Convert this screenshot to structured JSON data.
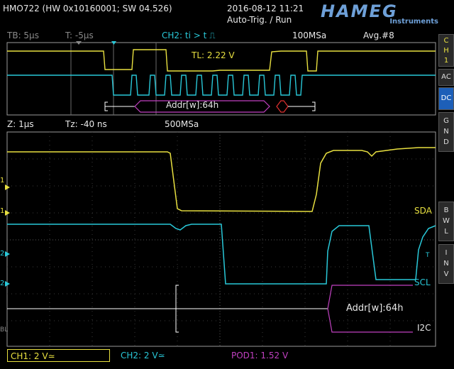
{
  "header": {
    "device": "HMO722 (HW 0x10160001; SW 04.526)",
    "datetime": "2016-08-12 11:21",
    "trigger_mode": "Auto-Trig. / Run",
    "brand": "HAMEG",
    "brand_sub": "Instruments"
  },
  "zoom_info": {
    "tb": "TB: 5µs",
    "t": "T: -5µs",
    "trigger": "CH2: ti > t ⎍",
    "sample_rate": "100MSa",
    "avg": "Avg.#8",
    "tl": "TL: 2.22 V",
    "decode": "Addr[w]:64h"
  },
  "main_info": {
    "z": "Z: 1µs",
    "tz": "Tz: -40 ns",
    "sample_rate": "500MSa"
  },
  "channels": {
    "sda": "SDA",
    "scl": "SCL",
    "i2c": "I2C",
    "decode": "Addr[w]:64h"
  },
  "markers": {
    "m1": "1",
    "m2": "2",
    "m2b": "2",
    "bl": "BL",
    "tmark": "T"
  },
  "side_panel": {
    "ch": "C\nH\n1",
    "ac": "AC",
    "dc": "DC",
    "gnd": "G\nN\nD",
    "bwl": "B\nW\nL",
    "inv": "I\nN\nV"
  },
  "footer": {
    "ch1": "CH1: 2 V≃",
    "ch2": "CH2: 2 V≃",
    "pod1": "POD1: 1.52 V"
  },
  "colors": {
    "ch1": "#e8e040",
    "ch2": "#29c8d8",
    "pod": "#c040c0",
    "active_button": "#1d5fb8"
  }
}
